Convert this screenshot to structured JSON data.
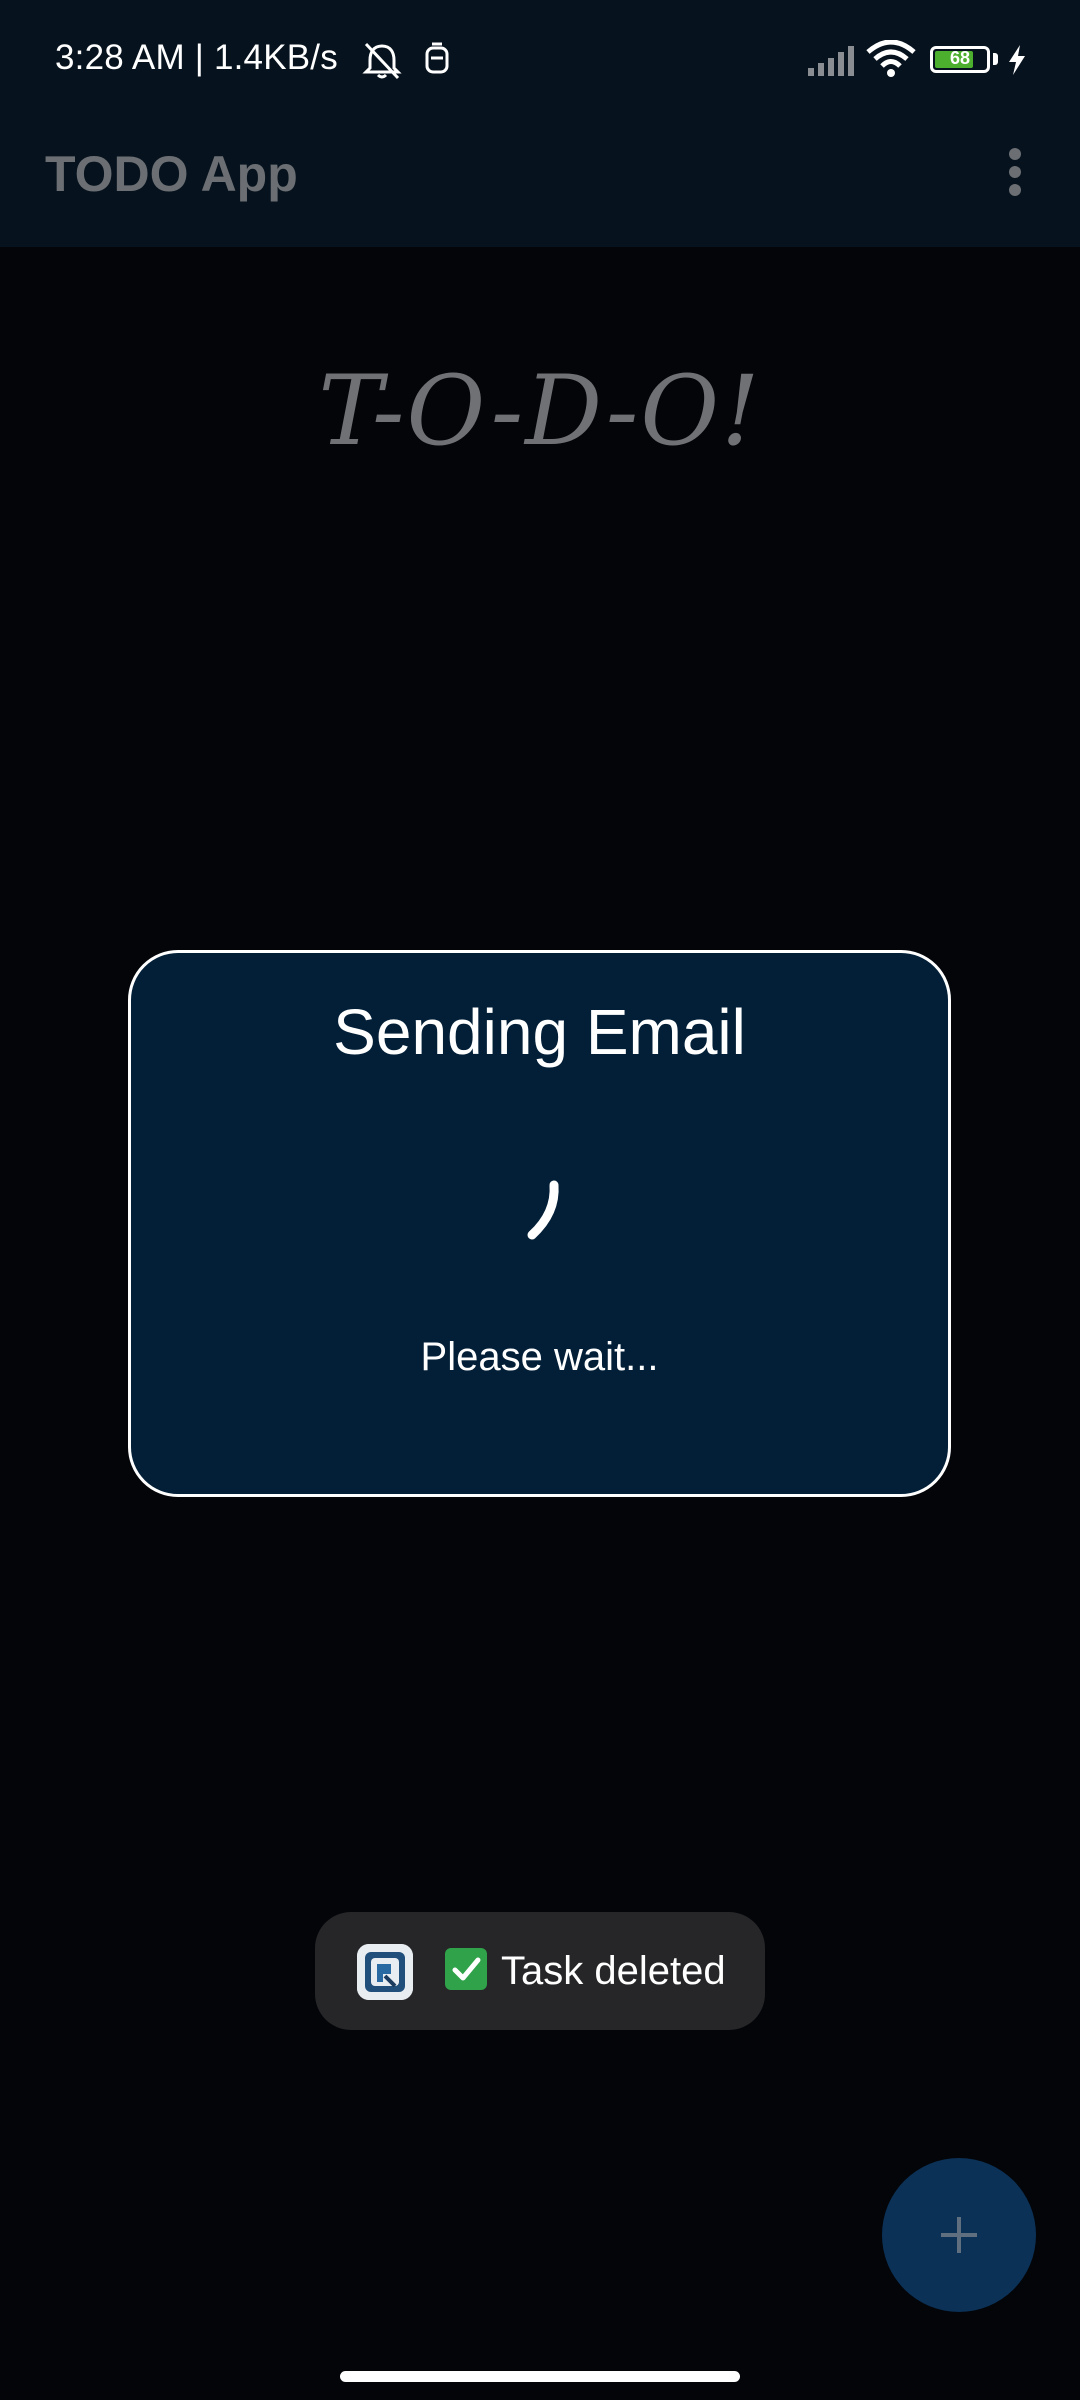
{
  "status_bar": {
    "time_speed": "3:28 AM | 1.4KB/s",
    "battery_level": "68",
    "icons": [
      "mute-notifications-icon",
      "app-notification-icon",
      "cellular-signal-icon",
      "wifi-icon",
      "battery-icon",
      "charging-icon"
    ]
  },
  "toolbar": {
    "title": "TODO App",
    "menu_icon": "more-vert-icon"
  },
  "logo": {
    "text": "T-O-D-O!"
  },
  "dialog": {
    "title": "Sending Email",
    "message": "Please wait..."
  },
  "toast": {
    "text": "Task deleted",
    "icon": "check-mark-icon"
  },
  "fab": {
    "icon": "plus-icon"
  },
  "colors": {
    "topbar_bg": "#06121d",
    "background": "#030509",
    "dialog_bg": "#021f37",
    "fab_bg": "#0b3156",
    "toolbar_text": "#6b6f73"
  }
}
